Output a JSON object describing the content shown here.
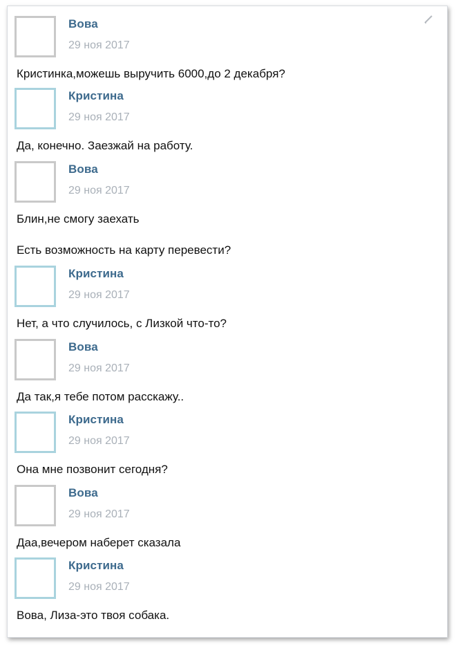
{
  "messages": [
    {
      "author": "Вова",
      "date": "29 ноя 2017",
      "lines": [
        "Кристинка,можешь выручить 6000,до 2 декабря?"
      ]
    },
    {
      "author": "Кристина",
      "date": "29 ноя 2017",
      "lines": [
        "Да, конечно. Заезжай на работу."
      ]
    },
    {
      "author": "Вова",
      "date": "29 ноя 2017",
      "lines": [
        "Блин,не смогу заехать",
        "Есть возможность на карту перевести?"
      ]
    },
    {
      "author": "Кристина",
      "date": "29 ноя 2017",
      "lines": [
        "Нет, а что случилось, с Лизкой что-то?"
      ]
    },
    {
      "author": "Вова",
      "date": "29 ноя 2017",
      "lines": [
        "Да так,я тебе потом расскажу.."
      ]
    },
    {
      "author": "Кристина",
      "date": "29 ноя 2017",
      "lines": [
        "Она мне позвонит сегодня?"
      ]
    },
    {
      "author": "Вова",
      "date": "29 ноя 2017",
      "lines": [
        "Даа,вечером наберет сказала"
      ]
    },
    {
      "author": "Кристина",
      "date": "29 ноя 2017",
      "lines": [
        "Вова, Лиза-это твоя собака."
      ]
    }
  ],
  "colors": {
    "name": "#3d6a8d",
    "date": "#a9b0b8",
    "avatar_border_vova": "#c9c9c9",
    "avatar_border_kristina": "#a9d3de"
  },
  "icons": {
    "edit": "pencil-icon"
  }
}
